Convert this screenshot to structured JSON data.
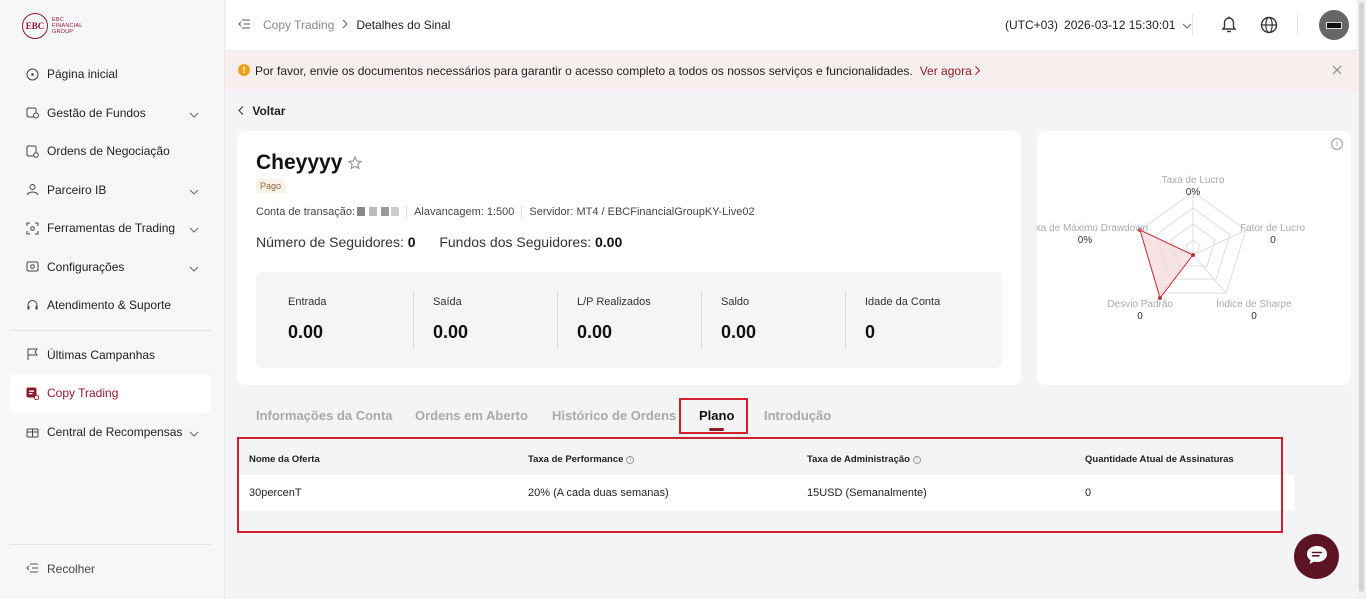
{
  "sidebar": {
    "logo_mark": "EBC",
    "logo_text": "EBC FINANCIAL GROUP",
    "items": [
      {
        "label": "Página inicial"
      },
      {
        "label": "Gestão de Fundos"
      },
      {
        "label": "Ordens de Negociação"
      },
      {
        "label": "Parceiro IB"
      },
      {
        "label": "Ferramentas de Trading"
      },
      {
        "label": "Configurações"
      },
      {
        "label": "Atendimento & Suporte"
      },
      {
        "label": "Últimas Campanhas"
      },
      {
        "label": "Copy Trading"
      },
      {
        "label": "Central de Recompensas"
      }
    ],
    "collapse_label": "Recolher"
  },
  "header": {
    "breadcrumb_parent": "Copy Trading",
    "breadcrumb_current": "Detalhes do Sinal",
    "timezone": "(UTC+03)",
    "datetime": "2026-03-12 15:30:01"
  },
  "notice": {
    "message": "Por favor, envie os documentos necessários para garantir o acesso completo a todos os nossos serviços e funcionalidades.",
    "link": "Ver agora"
  },
  "back_label": "Voltar",
  "profile": {
    "name": "Cheyyyy",
    "badge": "Pago",
    "account_label": "Conta de transação:",
    "leverage": "Alavancagem: 1:500",
    "server": "Servidor: MT4 / EBCFinancialGroupKY-Live02",
    "followers_label": "Número de Seguidores:",
    "followers_value": "0",
    "funds_label": "Fundos dos Seguidores:",
    "funds_value": "0.00"
  },
  "stats": [
    {
      "label": "Entrada",
      "value": "0.00"
    },
    {
      "label": "Saída",
      "value": "0.00"
    },
    {
      "label": "L/P Realizados",
      "value": "0.00"
    },
    {
      "label": "Saldo",
      "value": "0.00"
    },
    {
      "label": "Idade da Conta",
      "value": "0"
    }
  ],
  "radar": {
    "axes": [
      {
        "label": "Taxa de Lucro",
        "value": "0%"
      },
      {
        "label": "Fator de Lucro",
        "value": "0"
      },
      {
        "label": "Índice de Sharpe",
        "value": "0"
      },
      {
        "label": "Desvio Padrão",
        "value": "0"
      },
      {
        "label": "Taxa de Máximo Drawdown",
        "value": "0%"
      }
    ],
    "colors": {
      "grid": "#dddddd",
      "series": "#c0303c",
      "fill": "#f3d6d9"
    }
  },
  "tabs": [
    {
      "label": "Informações da Conta"
    },
    {
      "label": "Ordens em Aberto"
    },
    {
      "label": "Histórico de Ordens"
    },
    {
      "label": "Plano"
    },
    {
      "label": "Introdução"
    }
  ],
  "table": {
    "headers": [
      "Nome da Oferta",
      "Taxa de Performance",
      "Taxa de Administração",
      "Quantidade Atual de Assinaturas"
    ],
    "rows": [
      [
        "30percenT",
        "20% (A cada duas semanas)",
        "15USD (Semanalmente)",
        "0"
      ]
    ]
  },
  "colors": {
    "brand": "#8b1a2b",
    "highlight": "#d0202e",
    "warning": "#f0a020"
  }
}
